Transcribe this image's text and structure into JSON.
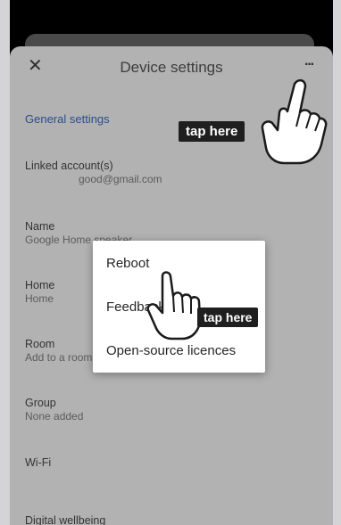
{
  "header": {
    "close_icon": "close-icon",
    "title": "Device settings",
    "more_icon": "more-options-icon",
    "more_glyph": "···"
  },
  "sections": {
    "general_settings": "General settings"
  },
  "rows": {
    "linked_account": {
      "label": "Linked account(s)",
      "value": "good@gmail.com"
    },
    "name": {
      "label": "Name",
      "value": "Google Home speaker"
    },
    "home": {
      "label": "Home",
      "value": "Home"
    },
    "room": {
      "label": "Room",
      "value": "Add to a room"
    },
    "group": {
      "label": "Group",
      "value": "None added"
    },
    "wifi": {
      "label": "Wi-Fi"
    },
    "digital_wellbeing": {
      "label": "Digital wellbeing"
    }
  },
  "menu": {
    "items": [
      "Reboot",
      "Feedback",
      "Open-source licences"
    ]
  },
  "annotations": {
    "tap_here_1": "tap here",
    "tap_here_2": "tap here"
  },
  "colors": {
    "accent_blue": "#2a4d8c",
    "scrim_gray": "#b2b2b2",
    "menu_bg": "#ffffff",
    "label_bg": "#1f1f1f"
  }
}
